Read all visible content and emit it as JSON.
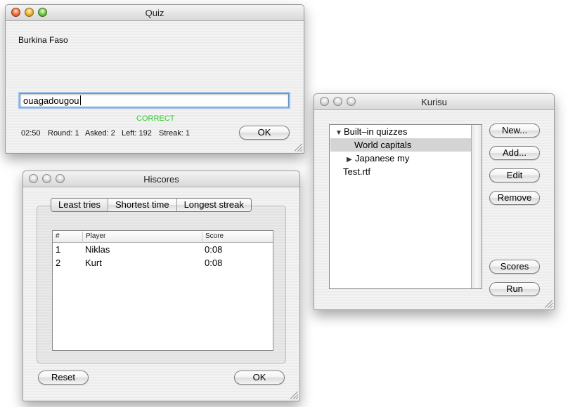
{
  "quiz": {
    "title": "Quiz",
    "question": "Burkina Faso",
    "answer": "ouagadougou",
    "result": "CORRECT",
    "timer": "02:50",
    "round": "Round: 1",
    "asked": "Asked: 2",
    "left": "Left: 192",
    "streak": "Streak: 1",
    "ok_label": "OK"
  },
  "hiscores": {
    "title": "Hiscores",
    "tabs": [
      "Least tries",
      "Shortest time",
      "Longest streak"
    ],
    "columns": [
      "#",
      "Player",
      "Score"
    ],
    "rows": [
      {
        "rank": "1",
        "player": "Niklas",
        "score": "0:08"
      },
      {
        "rank": "2",
        "player": "Kurt",
        "score": "0:08"
      }
    ],
    "reset_label": "Reset",
    "ok_label": "OK"
  },
  "kurisu": {
    "title": "Kurisu",
    "tree": [
      {
        "label": "Built–in quizzes",
        "expanded": true
      },
      {
        "label": "World capitals",
        "selected": true
      },
      {
        "label": "Japanese my",
        "expanded": false
      },
      {
        "label": "Test.rtf"
      }
    ],
    "buttons": {
      "new": "New...",
      "add": "Add...",
      "edit": "Edit",
      "remove": "Remove",
      "scores": "Scores",
      "run": "Run"
    }
  }
}
